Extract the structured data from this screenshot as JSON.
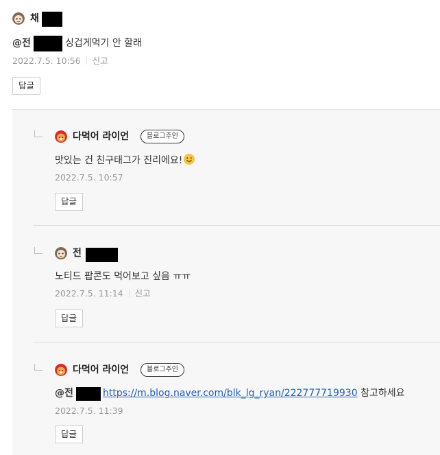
{
  "top_comment": {
    "author": "채",
    "mention": "@전",
    "text": "싱겁게먹기 안 할래",
    "date": "2022.7.5. 10:56",
    "report": "신고",
    "reply_label": "답글"
  },
  "replies": [
    {
      "author": "다먹어 라이언",
      "badge": "블로그주인",
      "text": "맛있는 건 친구태그가 진리에요!",
      "date": "2022.7.5. 10:57",
      "reply_label": "답글"
    },
    {
      "author": "전",
      "text": "노티드 팝콘도 먹어보고 싶음 ㅠㅠ",
      "date": "2022.7.5. 11:14",
      "report": "신고",
      "reply_label": "답글"
    },
    {
      "author": "다먹어 라이언",
      "badge": "블로그주인",
      "mention": "@전",
      "link": "https://m.blog.naver.com/blk_lg_ryan/222777719930",
      "text_after": "참고하세요",
      "date": "2022.7.5. 11:39",
      "reply_label": "답글"
    }
  ]
}
